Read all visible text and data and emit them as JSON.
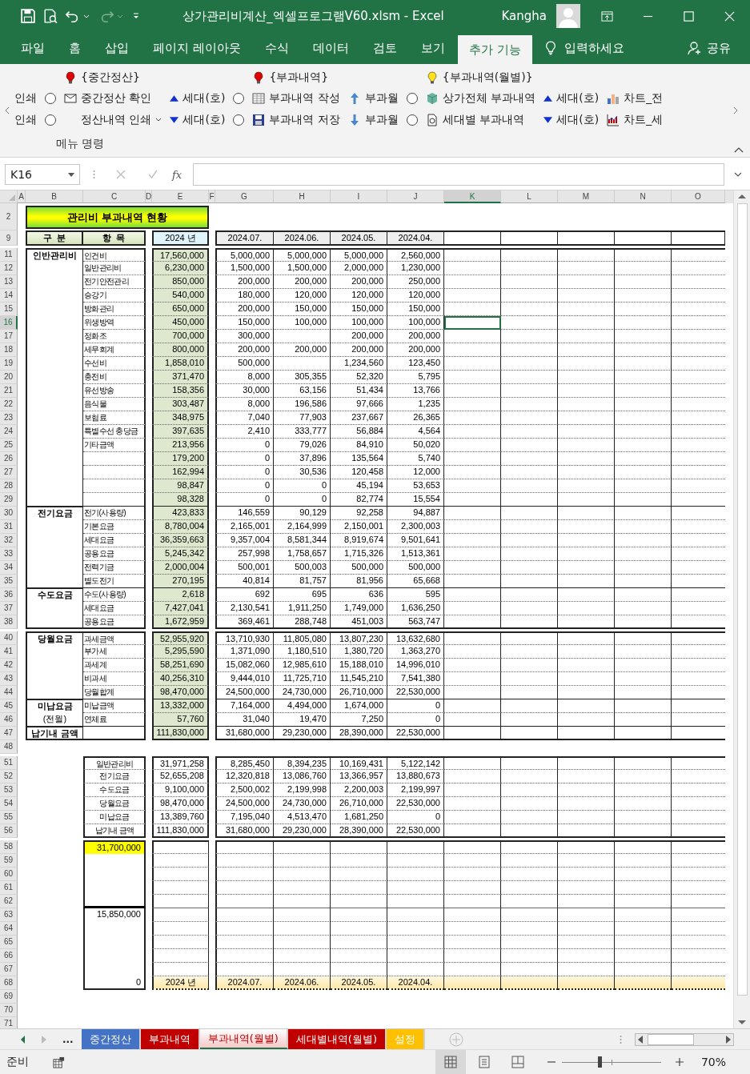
{
  "title_bar": {
    "title": "상가관리비계산_엑셀프로그램V60.xlsm  -  Excel",
    "user": "Kangha"
  },
  "ribbon_tabs": [
    {
      "label": "파일",
      "selected": false
    },
    {
      "label": "홈",
      "selected": false
    },
    {
      "label": "삽입",
      "selected": false
    },
    {
      "label": "페이지 레이아웃",
      "selected": false
    },
    {
      "label": "수식",
      "selected": false
    },
    {
      "label": "데이터",
      "selected": false
    },
    {
      "label": "검토",
      "selected": false
    },
    {
      "label": "보기",
      "selected": false
    },
    {
      "label": "추가 기능",
      "selected": true
    }
  ],
  "tell_me": "입력하세요",
  "share": "공유",
  "ribbon": {
    "group_label": "메뉴 명령",
    "columns": [
      {
        "items": [
          {
            "kind": "text",
            "label": "인쇄"
          },
          {
            "kind": "text",
            "label": "인쇄"
          }
        ]
      },
      {
        "items": [
          {
            "kind": "radio",
            "selected": false
          },
          {
            "kind": "radio",
            "selected": false
          }
        ]
      },
      {
        "header": {
          "label": "{중간정산}",
          "color": "#e00000"
        },
        "items": [
          {
            "kind": "envelope",
            "label": "중간정산 확인"
          },
          {
            "kind": "dropdown",
            "label": "정산내역 인쇄"
          }
        ]
      },
      {
        "items": [
          {
            "kind": "caret_up",
            "label": "세대(호)"
          },
          {
            "kind": "caret_down",
            "label": "세대(호)"
          }
        ]
      },
      {
        "items": [
          {
            "kind": "radio",
            "selected": false
          },
          {
            "kind": "radio",
            "selected": false
          }
        ]
      },
      {
        "header": {
          "label": "{부과내역}",
          "color": "#e00000"
        },
        "items": [
          {
            "kind": "table",
            "label": "부과내역 작성"
          },
          {
            "kind": "save",
            "label": "부과내역 저장"
          }
        ]
      },
      {
        "items": [
          {
            "kind": "arrow_up",
            "label": "부과월"
          },
          {
            "kind": "arrow_down",
            "label": "부과월"
          }
        ]
      },
      {
        "items": [
          {
            "kind": "radio",
            "selected": false
          },
          {
            "kind": "radio",
            "selected": false
          }
        ]
      },
      {
        "header": {
          "label": "{부과내역(월별)}",
          "color": "#ffe21a"
        },
        "items": [
          {
            "kind": "cube",
            "label": "상가전체 부과내역"
          },
          {
            "kind": "doc",
            "label": "세대별 부과내역"
          }
        ]
      },
      {
        "items": [
          {
            "kind": "caret_up",
            "label": "세대(호)"
          },
          {
            "kind": "caret_down",
            "label": "세대(호)"
          }
        ]
      },
      {
        "items": [
          {
            "kind": "chart_bar",
            "label": "차트_전"
          },
          {
            "kind": "chart_line",
            "label": "차트_세"
          }
        ]
      }
    ]
  },
  "formula_bar": {
    "name_box": "K16",
    "function_label": "fx"
  },
  "sheet": {
    "columns": [
      {
        "label": "A",
        "selected": false
      },
      {
        "label": "B",
        "selected": false
      },
      {
        "label": "C",
        "selected": false
      },
      {
        "label": "D",
        "selected": false
      },
      {
        "label": "E",
        "selected": false
      },
      {
        "label": "F",
        "selected": false
      },
      {
        "label": "G",
        "selected": false
      },
      {
        "label": "H",
        "selected": false
      },
      {
        "label": "I",
        "selected": false
      },
      {
        "label": "J",
        "selected": false
      },
      {
        "label": "K",
        "selected": true
      },
      {
        "label": "L",
        "selected": false
      },
      {
        "label": "M",
        "selected": false
      },
      {
        "label": "N",
        "selected": false
      },
      {
        "label": "O",
        "selected": false
      }
    ],
    "title_row": {
      "num": "2",
      "title": "관리비 부과내역 현황"
    },
    "header_row": {
      "num": "9",
      "category": "구  분",
      "item": "항  목",
      "year": "2024 년",
      "months": [
        "2024.07.",
        "2024.06.",
        "2024.05.",
        "2024.04."
      ]
    },
    "sections": [
      {
        "groups": [
          {
            "label": "인반관리비",
            "rows": [
              {
                "num": "11",
                "selected": false,
                "item": "인건비",
                "total": "17,560,000",
                "values": [
                  "5,000,000",
                  "5,000,000",
                  "5,000,000",
                  "2,560,000"
                ]
              },
              {
                "num": "12",
                "selected": false,
                "item": "일반관리비",
                "total": "6,230,000",
                "values": [
                  "1,500,000",
                  "1,500,000",
                  "2,000,000",
                  "1,230,000"
                ]
              },
              {
                "num": "13",
                "selected": false,
                "item": "전기안전관리",
                "total": "850,000",
                "values": [
                  "200,000",
                  "200,000",
                  "200,000",
                  "250,000"
                ]
              },
              {
                "num": "14",
                "selected": false,
                "item": "승강기",
                "total": "540,000",
                "values": [
                  "180,000",
                  "120,000",
                  "120,000",
                  "120,000"
                ]
              },
              {
                "num": "15",
                "selected": false,
                "item": "방화관리",
                "total": "650,000",
                "values": [
                  "200,000",
                  "150,000",
                  "150,000",
                  "150,000"
                ]
              },
              {
                "num": "16",
                "selected": true,
                "item": "위생방역",
                "total": "450,000",
                "values": [
                  "150,000",
                  "100,000",
                  "100,000",
                  "100,000"
                ]
              },
              {
                "num": "17",
                "selected": false,
                "item": "정화조",
                "total": "700,000",
                "values": {
                  "column_g": "300,000",
                  "column_i": "200,000",
                  "column_j": "200,000"
                }
              },
              {
                "num": "18",
                "selected": false,
                "item": "세무회계",
                "total": "800,000",
                "values": [
                  "200,000",
                  "200,000",
                  "200,000",
                  "200,000"
                ]
              },
              {
                "num": "19",
                "selected": false,
                "item": "수선비",
                "total": "1,858,010",
                "values": {
                  "column_g": "500,000",
                  "column_i": "1,234,560",
                  "column_j": "123,450"
                }
              },
              {
                "num": "20",
                "selected": false,
                "item": "충전비",
                "total": "371,470",
                "values": [
                  "8,000",
                  "305,355",
                  "52,320",
                  "5,795"
                ]
              },
              {
                "num": "21",
                "selected": false,
                "item": "유선방송",
                "total": "158,356",
                "values": [
                  "30,000",
                  "63,156",
                  "51,434",
                  "13,766"
                ]
              },
              {
                "num": "22",
                "selected": false,
                "item": "음식물",
                "total": "303,487",
                "values": [
                  "8,000",
                  "196,586",
                  "97,666",
                  "1,235"
                ]
              },
              {
                "num": "23",
                "selected": false,
                "item": "보험료",
                "total": "348,975",
                "values": [
                  "7,040",
                  "77,903",
                  "237,667",
                  "26,365"
                ]
              },
              {
                "num": "24",
                "selected": false,
                "item": "특별수선 충당금",
                "total": "397,635",
                "values": [
                  "2,410",
                  "333,777",
                  "56,884",
                  "4,564"
                ]
              },
              {
                "num": "25",
                "selected": false,
                "item": "기타금액",
                "total": "213,956",
                "values": [
                  "0",
                  "79,026",
                  "84,910",
                  "50,020"
                ]
              },
              {
                "num": "26",
                "selected": false,
                "total": "179,200",
                "values": [
                  "0",
                  "37,896",
                  "135,564",
                  "5,740"
                ]
              },
              {
                "num": "27",
                "selected": false,
                "total": "162,994",
                "values": [
                  "0",
                  "30,536",
                  "120,458",
                  "12,000"
                ]
              },
              {
                "num": "28",
                "selected": false,
                "total": "98,847",
                "values": [
                  "0",
                  "0",
                  "45,194",
                  "53,653"
                ]
              },
              {
                "num": "29",
                "selected": false,
                "total": "98,328",
                "values": [
                  "0",
                  "0",
                  "82,774",
                  "15,554"
                ]
              }
            ]
          },
          {
            "label": "전기요금",
            "rows": [
              {
                "num": "30",
                "selected": false,
                "item": "전기(사용량)",
                "total": "423,833",
                "values": [
                  "146,559",
                  "90,129",
                  "92,258",
                  "94,887"
                ]
              },
              {
                "num": "31",
                "selected": false,
                "item": "기본요금",
                "total": "8,780,004",
                "values": [
                  "2,165,001",
                  "2,164,999",
                  "2,150,001",
                  "2,300,003"
                ]
              },
              {
                "num": "32",
                "selected": false,
                "item": "세대요금",
                "total": "36,359,663",
                "values": [
                  "9,357,004",
                  "8,581,344",
                  "8,919,674",
                  "9,501,641"
                ]
              },
              {
                "num": "33",
                "selected": false,
                "item": "공용요금",
                "total": "5,245,342",
                "values": [
                  "257,998",
                  "1,758,657",
                  "1,715,326",
                  "1,513,361"
                ]
              },
              {
                "num": "34",
                "selected": false,
                "item": "전력기금",
                "total": "2,000,004",
                "values": [
                  "500,001",
                  "500,003",
                  "500,000",
                  "500,000"
                ]
              },
              {
                "num": "35",
                "selected": false,
                "item": "별도전기",
                "total": "270,195",
                "values": [
                  "40,814",
                  "81,757",
                  "81,956",
                  "65,668"
                ]
              }
            ]
          },
          {
            "label": "수도요금",
            "rows": [
              {
                "num": "36",
                "selected": false,
                "item": "수도(사용량)",
                "total": "2,618",
                "values": [
                  "692",
                  "695",
                  "636",
                  "595"
                ]
              },
              {
                "num": "37",
                "selected": false,
                "item": "세대요금",
                "total": "7,427,041",
                "values": [
                  "2,130,541",
                  "1,911,250",
                  "1,749,000",
                  "1,636,250"
                ]
              },
              {
                "num": "38",
                "selected": false,
                "item": "공용요금",
                "total": "1,672,959",
                "values": [
                  "369,461",
                  "288,748",
                  "451,003",
                  "563,747"
                ]
              }
            ]
          }
        ]
      },
      {
        "groups": [
          {
            "label": "당월요금",
            "rows": [
              {
                "num": "40",
                "selected": false,
                "item": "과세금액",
                "total": "52,955,920",
                "values": [
                  "13,710,930",
                  "11,805,080",
                  "13,807,230",
                  "13,632,680"
                ]
              },
              {
                "num": "41",
                "selected": false,
                "item": "부가세",
                "total": "5,295,590",
                "values": [
                  "1,371,090",
                  "1,180,510",
                  "1,380,720",
                  "1,363,270"
                ]
              },
              {
                "num": "42",
                "selected": false,
                "item": "과세계",
                "total": "58,251,690",
                "values": [
                  "15,082,060",
                  "12,985,610",
                  "15,188,010",
                  "14,996,010"
                ]
              },
              {
                "num": "43",
                "selected": false,
                "item": "비과세",
                "total": "40,256,310",
                "values": [
                  "9,444,010",
                  "11,725,710",
                  "11,545,210",
                  "7,541,380"
                ]
              },
              {
                "num": "44",
                "selected": false,
                "item": "당월합계",
                "total": "98,470,000",
                "values": [
                  "24,500,000",
                  "24,730,000",
                  "26,710,000",
                  "22,530,000"
                ]
              }
            ]
          },
          {
            "label": "미납요금",
            "note": "(전월)",
            "rows": [
              {
                "num": "45",
                "selected": false,
                "item": "미납금액",
                "total": "13,332,000",
                "values": [
                  "7,164,000",
                  "4,494,000",
                  "1,674,000",
                  "0"
                ]
              },
              {
                "num": "46",
                "selected": false,
                "item": "연체료",
                "total": "57,760",
                "values": [
                  "31,040",
                  "19,470",
                  "7,250",
                  "0"
                ]
              }
            ]
          },
          {
            "label": "납기내 금액",
            "rows": [
              {
                "num": "47",
                "selected": false,
                "total": "111,830,000",
                "values": [
                  "31,680,000",
                  "29,230,000",
                  "28,390,000",
                  "22,530,000"
                ]
              }
            ]
          }
        ]
      }
    ],
    "blank_row": "48",
    "summary_rows": [
      {
        "num": "51",
        "item": "일반관리비",
        "total": "31,971,258",
        "values": [
          "8,285,450",
          "8,394,235",
          "10,169,431",
          "5,122,142"
        ]
      },
      {
        "num": "52",
        "item": "전기요금",
        "total": "52,655,208",
        "values": [
          "12,320,818",
          "13,086,760",
          "13,366,957",
          "13,880,673"
        ]
      },
      {
        "num": "53",
        "item": "수도요금",
        "total": "9,100,000",
        "values": [
          "2,500,002",
          "2,199,998",
          "2,200,003",
          "2,199,997"
        ]
      },
      {
        "num": "54",
        "item": "당월요금",
        "total": "98,470,000",
        "values": [
          "24,500,000",
          "24,730,000",
          "26,710,000",
          "22,530,000"
        ]
      },
      {
        "num": "55",
        "item": "미납요금",
        "total": "13,389,760",
        "values": [
          "7,195,040",
          "4,513,470",
          "1,681,250",
          "0"
        ]
      },
      {
        "num": "56",
        "item": "납기내 금액",
        "total": "111,830,000",
        "values": [
          "31,680,000",
          "29,230,000",
          "28,390,000",
          "22,530,000"
        ]
      }
    ],
    "chart_grid": {
      "rows": [
        {
          "num": "58",
          "axis_label": "31,700,000",
          "highlighted": true
        },
        {
          "num": "59",
          "highlighted": false
        },
        {
          "num": "60",
          "highlighted": false
        },
        {
          "num": "61",
          "highlighted": false
        },
        {
          "num": "62",
          "highlighted": false
        },
        {
          "num": "63",
          "axis_label": "15,850,000",
          "highlighted": false
        },
        {
          "num": "64",
          "highlighted": false
        },
        {
          "num": "65",
          "highlighted": false
        },
        {
          "num": "66",
          "highlighted": false
        },
        {
          "num": "67",
          "highlighted": false
        },
        {
          "num": "68",
          "axis_label": "0",
          "highlighted": false
        }
      ],
      "footer": {
        "year": "2024 년",
        "months": [
          "2024.07.",
          "2024.06.",
          "2024.05.",
          "2024.04."
        ]
      }
    },
    "trailing_rows": [
      "69",
      "70",
      "71"
    ]
  },
  "sheet_tabs": {
    "more": "...",
    "tabs": [
      {
        "label": "중간정산",
        "color": "#4472c4",
        "selected": false
      },
      {
        "label": "부과내역",
        "color": "#c00000",
        "selected": false
      },
      {
        "label": "부과내역(월별)",
        "color": "#c00000",
        "selected": true
      },
      {
        "label": "세대별내역(월별)",
        "color": "#c00000",
        "selected": false
      },
      {
        "label": "설정",
        "color": "#ffc000",
        "selected": false
      }
    ]
  },
  "status_bar": {
    "status": "준비",
    "views": [
      {
        "kind": "normal",
        "selected": true
      },
      {
        "kind": "page_layout",
        "selected": false
      },
      {
        "kind": "page_break",
        "selected": false
      }
    ],
    "zoom": {
      "level": 0.38,
      "reading": "70%"
    }
  }
}
